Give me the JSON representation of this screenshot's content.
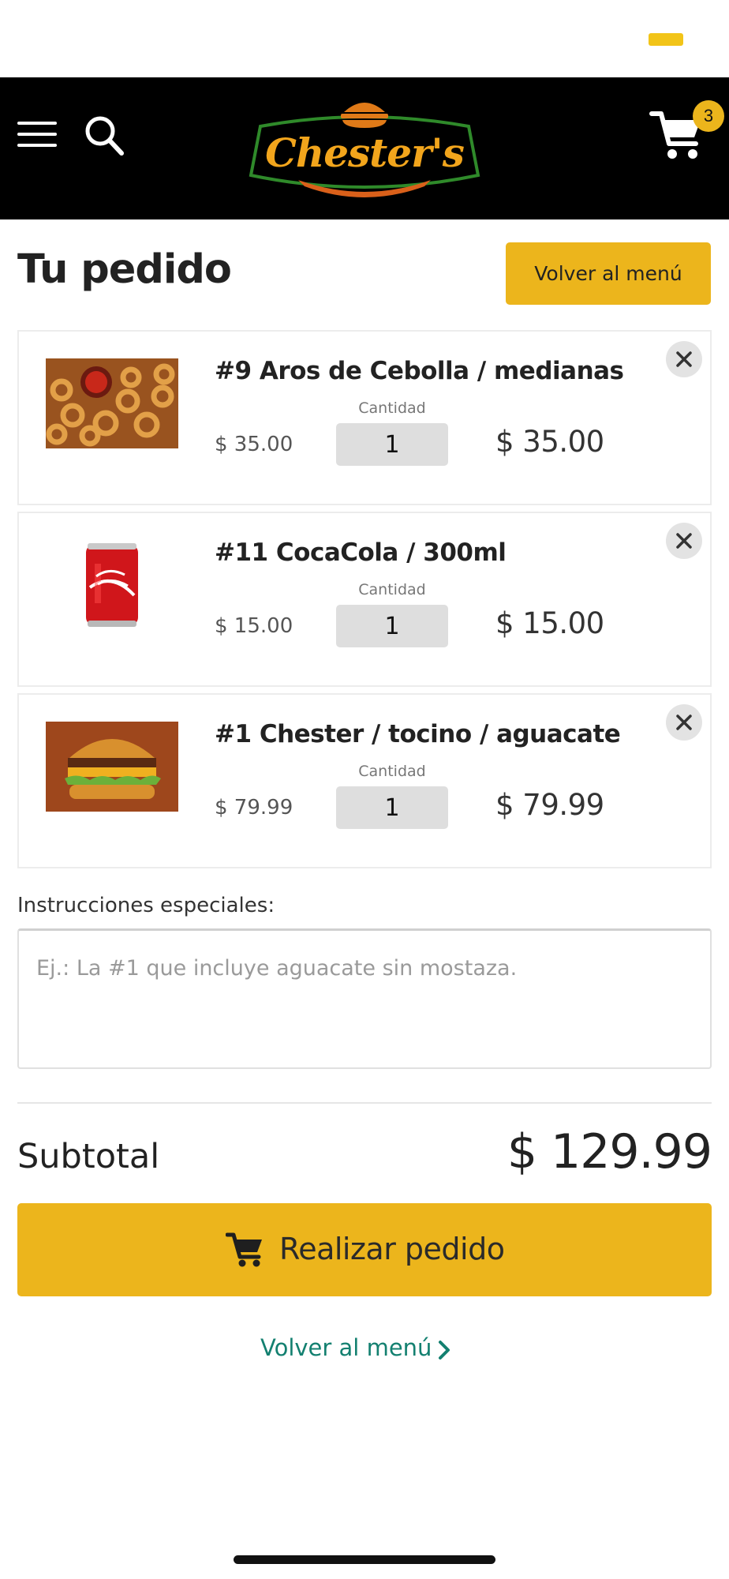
{
  "app": {
    "brand_name": "Chester's",
    "accent_color": "#ecb51c",
    "link_color": "#138070"
  },
  "header": {
    "menu_icon": "hamburger-menu-icon",
    "search_icon": "search-icon",
    "cart_icon": "shopping-cart-icon",
    "cart_count": "3"
  },
  "page": {
    "title": "Tu pedido",
    "back_button_label": "Volver al menú"
  },
  "order": {
    "quantity_label": "Cantidad",
    "items": [
      {
        "name": "#9 Aros de Cebolla / medianas",
        "unit_price": "$ 35.00",
        "quantity": "1",
        "line_total": "$ 35.00",
        "image": "onion-rings-photo"
      },
      {
        "name": "#11 CocaCola / 300ml",
        "unit_price": "$ 15.00",
        "quantity": "1",
        "line_total": "$ 15.00",
        "image": "coca-cola-can-photo"
      },
      {
        "name": "#1 Chester / tocino / aguacate",
        "unit_price": "$ 79.99",
        "quantity": "1",
        "line_total": "$ 79.99",
        "image": "burger-photo"
      }
    ]
  },
  "instructions": {
    "label": "Instrucciones especiales:",
    "placeholder": "Ej.: La #1 que incluye aguacate sin mostaza.",
    "value": ""
  },
  "summary": {
    "subtotal_label": "Subtotal",
    "subtotal_value": "$ 129.99"
  },
  "actions": {
    "checkout_label": "Realizar pedido",
    "checkout_icon": "shopping-cart-icon",
    "back_link_label": "Volver al menú"
  }
}
